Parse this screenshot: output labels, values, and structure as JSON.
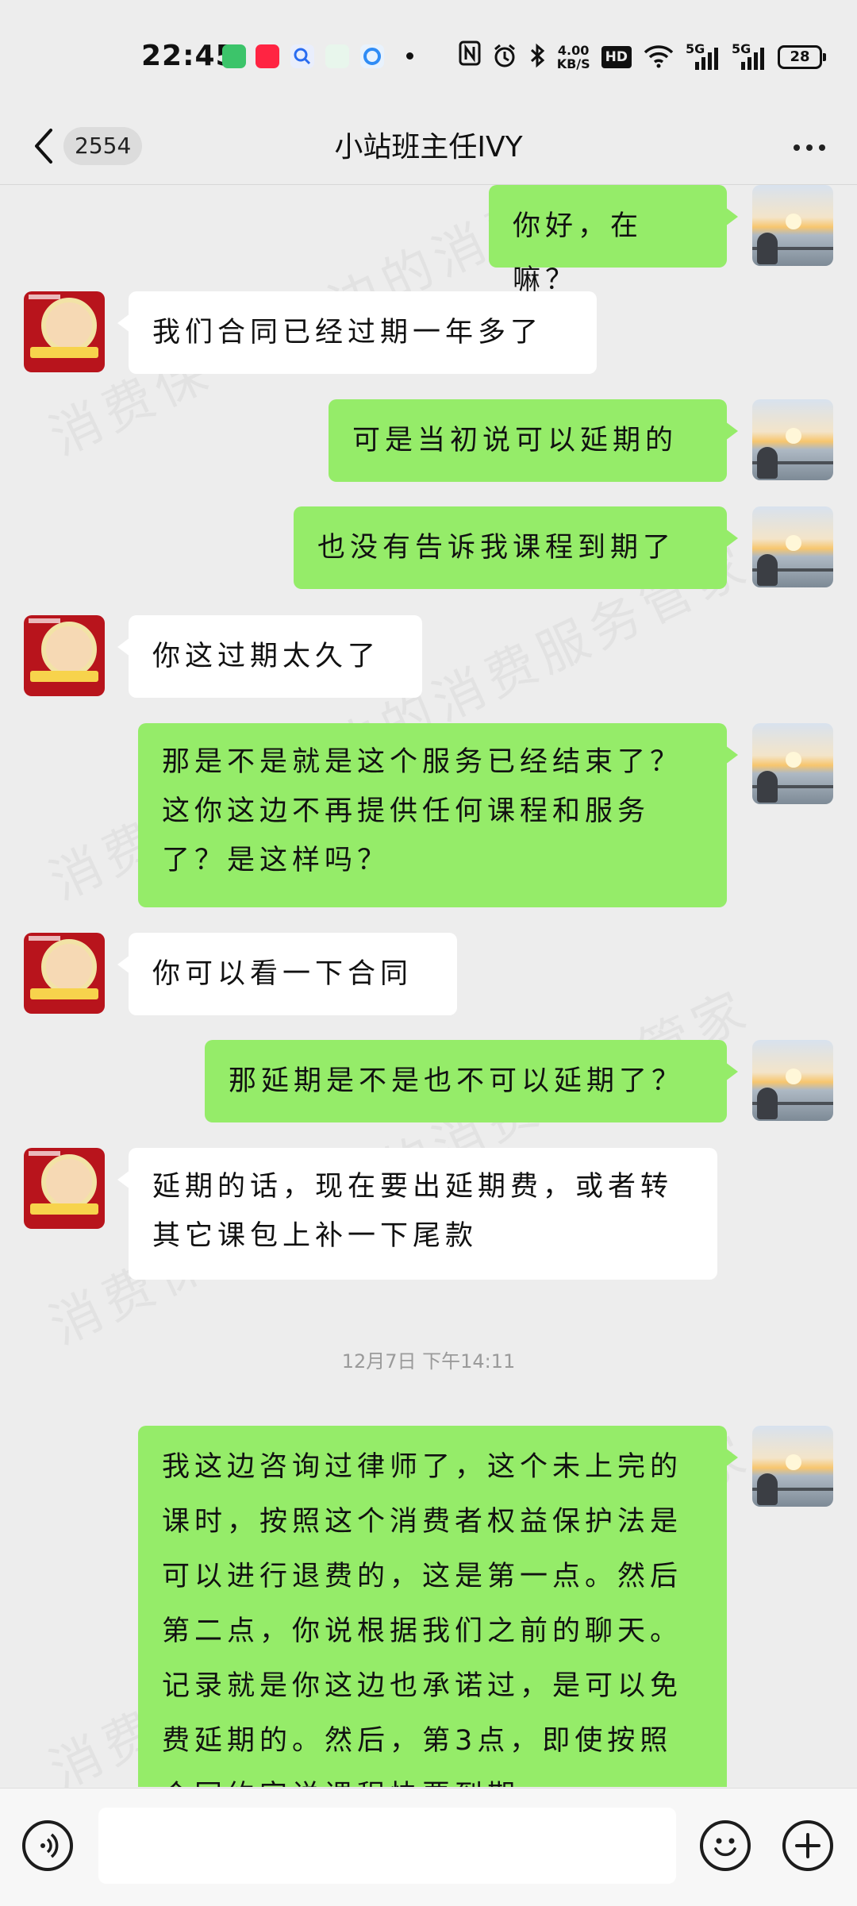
{
  "status_bar": {
    "time": "22:45",
    "network_speed_value": "4.00",
    "network_speed_unit": "KB/S",
    "hd_label": "HD",
    "signal1_label": "5G",
    "signal2_label": "5G",
    "battery_level": "28"
  },
  "header": {
    "unread_count": "2554",
    "title": "小站班主任IVY"
  },
  "messages": [
    {
      "side": "self",
      "text": "你好，在嘛？"
    },
    {
      "side": "other",
      "text": "我们合同已经过期一年多了"
    },
    {
      "side": "self",
      "text": "可是当初说可以延期的"
    },
    {
      "side": "self",
      "text": "也没有告诉我课程到期了"
    },
    {
      "side": "other",
      "text": "你这过期太久了"
    },
    {
      "side": "self",
      "text": "那是不是就是这个服务已经结束了？这你这边不再提供任何课程和服务了？是这样吗？"
    },
    {
      "side": "other",
      "text": "你可以看一下合同"
    },
    {
      "side": "self",
      "text": "那延期是不是也不可以延期了？"
    },
    {
      "side": "other",
      "text": "延期的话，现在要出延期费，或者转其它课包上补一下尾款"
    },
    {
      "side": "self",
      "text": "我这边咨询过律师了，这个未上完的课时，按照这个消费者权益保护法是可以进行退费的，这是第一点。然后第二点，你说根据我们之前的聊天。记录就是你这边也承诺过，是可以免费延期的。然后，第3点，即使按照合同约定说课程快要到期"
    }
  ],
  "timestamp": "12月7日 下午14:11",
  "watermark": "消费保 您身边的消费服务管家",
  "colors": {
    "self_bubble": "#95ec69",
    "other_bubble": "#ffffff",
    "background": "#ededed"
  },
  "icons": {
    "back": "chevron-left-icon",
    "more": "more-dots-icon",
    "voice": "voice-icon",
    "emoji": "emoji-icon",
    "add": "plus-icon"
  }
}
